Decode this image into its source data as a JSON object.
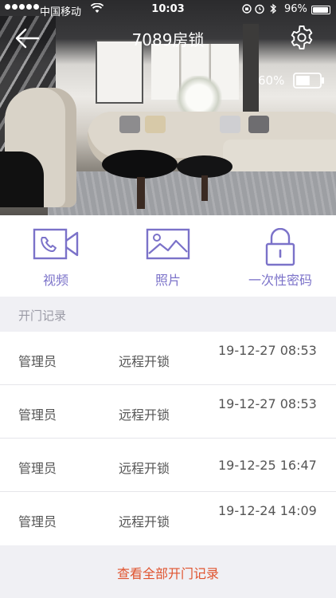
{
  "status_bar": {
    "carrier": "中国移动",
    "time": "10:03",
    "battery_percent": "96%",
    "battery_level": 0.96,
    "wifi_icon": "wifi-icon",
    "alarm_icon": "alarm-icon",
    "bluetooth_icon": "bluetooth-icon"
  },
  "header": {
    "title": "7089房锁",
    "back_icon": "back-arrow-icon",
    "settings_icon": "gear-icon",
    "lock_battery_label": "60%",
    "lock_battery_level": 0.6
  },
  "actions": [
    {
      "label": "视频",
      "icon": "video-camera-icon"
    },
    {
      "label": "照片",
      "icon": "photo-icon"
    },
    {
      "label": "一次性密码",
      "icon": "padlock-icon"
    }
  ],
  "records_section": {
    "title": "开门记录"
  },
  "records": [
    {
      "who": "管理员",
      "method": "远程开锁",
      "time": "19-12-27 08:53"
    },
    {
      "who": "管理员",
      "method": "远程开锁",
      "time": "19-12-27 08:53"
    },
    {
      "who": "管理员",
      "method": "远程开锁",
      "time": "19-12-25 16:47"
    },
    {
      "who": "管理员",
      "method": "远程开锁",
      "time": "19-12-24 14:09"
    }
  ],
  "footer": {
    "view_all_label": "查看全部开门记录"
  },
  "colors": {
    "accent": "#7b72c9",
    "link": "#e0532e",
    "section_bg": "#f0f0f4"
  }
}
